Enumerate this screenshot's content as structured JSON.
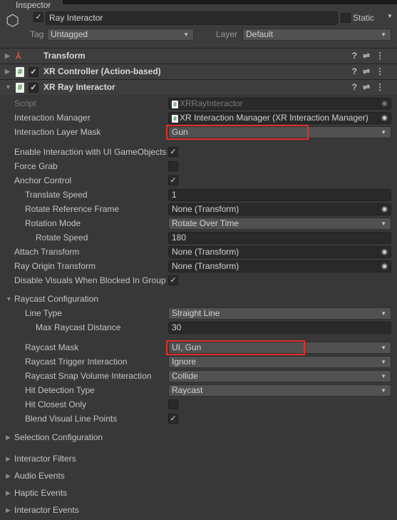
{
  "window": {
    "tab_title": "Inspector"
  },
  "gameobject": {
    "active": true,
    "name": "Ray Interactor",
    "static_label": "Static",
    "static": false,
    "tag_label": "Tag",
    "tag": "Untagged",
    "layer_label": "Layer",
    "layer": "Default"
  },
  "components": [
    {
      "name": "Transform",
      "icon": "transform-axes-icon",
      "expanded": false
    },
    {
      "name": "XR Controller (Action-based)",
      "icon": "csharp-script-icon",
      "enabled": true,
      "expanded": false
    },
    {
      "name": "XR Ray Interactor",
      "icon": "csharp-script-icon",
      "enabled": true,
      "expanded": true
    }
  ],
  "properties": [
    {
      "label": "Script",
      "value": "XRRayInteractor"
    },
    {
      "label": "Interaction Manager",
      "value": "XR Interaction Manager (XR Interaction Manager)"
    },
    {
      "label": "Interaction Layer Mask",
      "value": "Gun",
      "highlighted": true
    },
    {
      "label": "Enable Interaction with UI GameObjects",
      "checked": true
    },
    {
      "label": "Force Grab",
      "checked": false
    },
    {
      "label": "Anchor Control",
      "checked": true
    },
    {
      "label": "Translate Speed",
      "value": "1"
    },
    {
      "label": "Rotate Reference Frame",
      "value": "None (Transform)"
    },
    {
      "label": "Rotation Mode",
      "value": "Rotate Over Time"
    },
    {
      "label": "Rotate Speed",
      "value": "180"
    },
    {
      "label": "Attach Transform",
      "value": "None (Transform)"
    },
    {
      "label": "Ray Origin Transform",
      "value": "None (Transform)"
    },
    {
      "label": "Disable Visuals When Blocked In Group",
      "checked": true
    },
    {
      "label": "Raycast Configuration"
    },
    {
      "label": "Line Type",
      "value": "Straight Line"
    },
    {
      "label": "Max Raycast Distance",
      "value": "30"
    },
    {
      "label": "Raycast Mask",
      "value": "UI, Gun",
      "highlighted": true
    },
    {
      "label": "Raycast Trigger Interaction",
      "value": "Ignore"
    },
    {
      "label": "Raycast Snap Volume Interaction",
      "value": "Collide"
    },
    {
      "label": "Hit Detection Type",
      "value": "Raycast"
    },
    {
      "label": "Hit Closest Only",
      "checked": false
    },
    {
      "label": "Blend Visual Line Points",
      "checked": true
    },
    {
      "label": "Selection Configuration"
    },
    {
      "label": "Interactor Filters"
    },
    {
      "label": "Audio Events"
    },
    {
      "label": "Haptic Events"
    },
    {
      "label": "Interactor Events"
    }
  ],
  "colors": {
    "highlight": "#e03030",
    "background": "#383838"
  }
}
